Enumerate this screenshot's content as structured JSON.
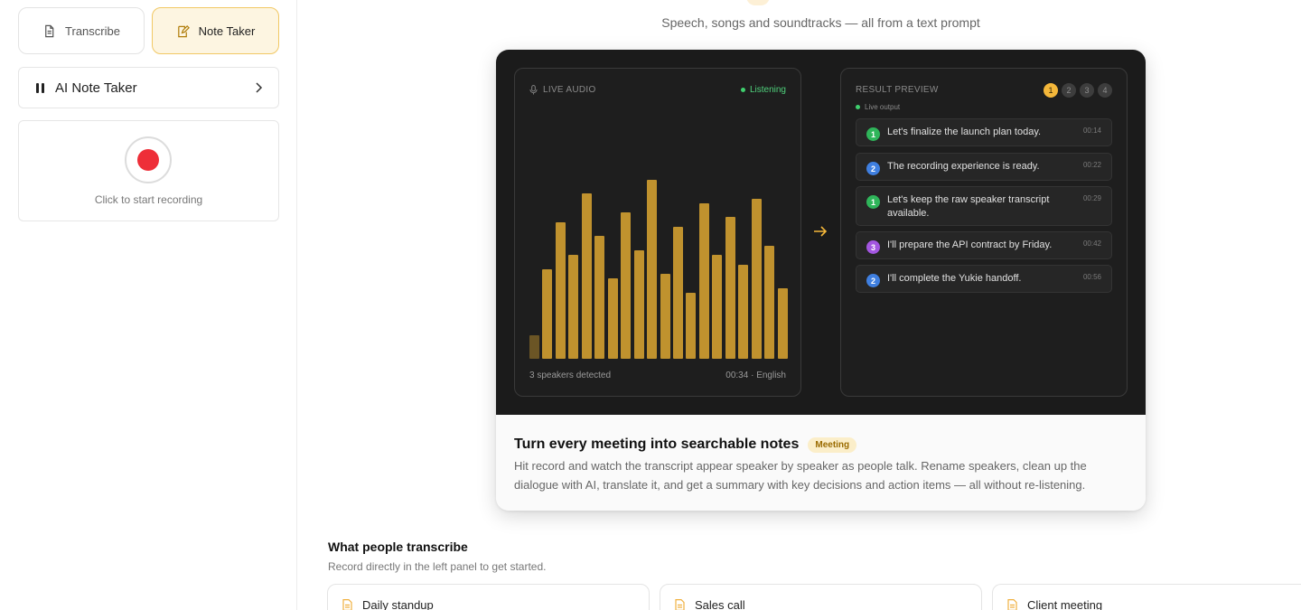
{
  "sidebar": {
    "modes": [
      {
        "label": "Transcribe",
        "icon": "document-icon"
      },
      {
        "label": "Note Taker",
        "icon": "note-edit-icon",
        "active": true
      }
    ],
    "selector": {
      "label": "AI Note Taker",
      "icon": "pause-icon"
    },
    "record": {
      "hint": "Click to start recording"
    }
  },
  "main": {
    "tagline": "Speech, songs and soundtracks — all from a text prompt",
    "demo": {
      "live_panel": {
        "title": "LIVE AUDIO",
        "status": "Listening",
        "speakers": "3 speakers detected",
        "meta": "00:34 · English",
        "levels": [
          0.1,
          0.38,
          0.58,
          0.44,
          0.7,
          0.52,
          0.34,
          0.62,
          0.46,
          0.76,
          0.36,
          0.56,
          0.28,
          0.66,
          0.44,
          0.6,
          0.4,
          0.68,
          0.48,
          0.3
        ]
      },
      "result_panel": {
        "title": "RESULT PREVIEW",
        "steps": [
          "1",
          "2",
          "3",
          "4"
        ],
        "live_output": "Live output",
        "utterances": [
          {
            "speaker": "1",
            "text": "Let's finalize the launch plan today.",
            "time": "00:14"
          },
          {
            "speaker": "2",
            "text": "The recording experience is ready.",
            "time": "00:22"
          },
          {
            "speaker": "1",
            "text": "Let's keep the raw speaker transcript available.",
            "time": "00:29"
          },
          {
            "speaker": "3",
            "text": "I'll prepare the API contract by Friday.",
            "time": "00:42"
          },
          {
            "speaker": "2",
            "text": "I'll complete the Yukie handoff.",
            "time": "00:56"
          }
        ]
      },
      "title": "Turn every meeting into searchable notes",
      "badge": "Meeting",
      "description": "Hit record and watch the transcript appear speaker by speaker as people talk. Rename speakers, clean up the dialogue with AI, translate it, and get a summary with key decisions and action items — all without re-listening."
    },
    "section": {
      "title": "What people transcribe",
      "subtitle": "Record directly in the left panel to get started.",
      "cards": [
        {
          "label": "Daily standup"
        },
        {
          "label": "Sales call"
        },
        {
          "label": "Client meeting"
        }
      ]
    }
  },
  "colors": {
    "accent": "#f4b73a",
    "record_red": "#ee2e38",
    "speaker_1": "#2fb55a",
    "speaker_2": "#3f7fe0",
    "speaker_3": "#a356e0",
    "bar": "#c0922e"
  }
}
